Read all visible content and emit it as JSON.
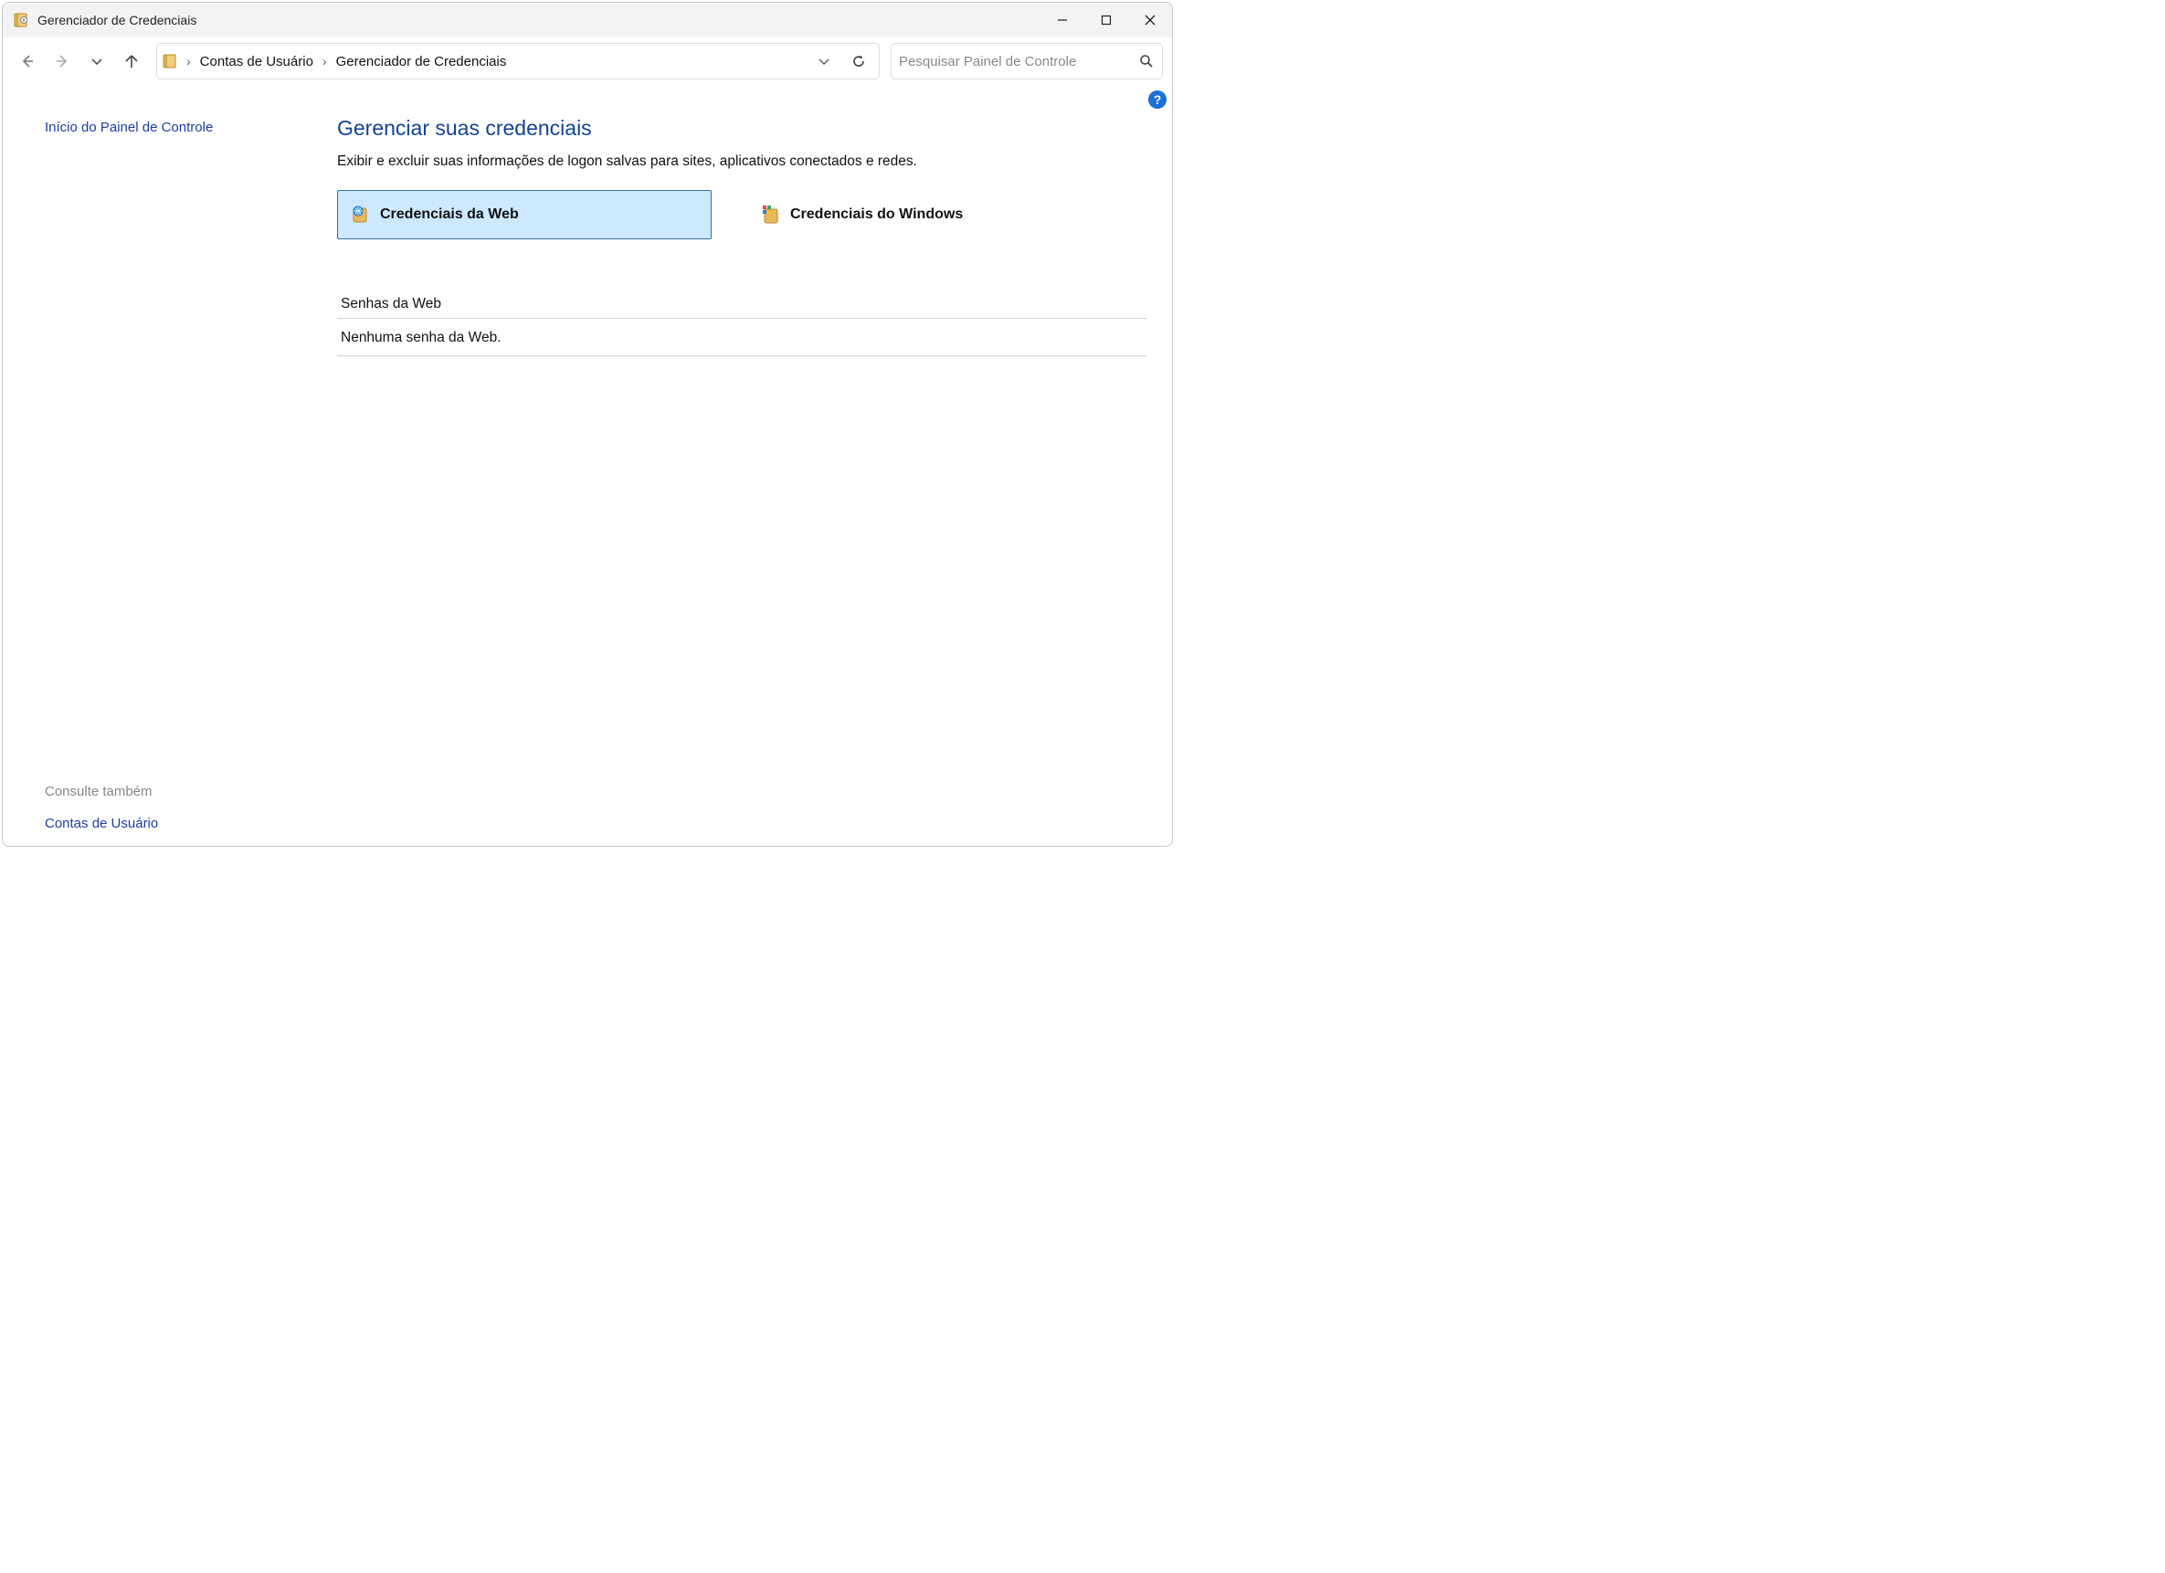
{
  "window": {
    "title": "Gerenciador de Credenciais"
  },
  "breadcrumb": {
    "items": [
      "Contas de Usuário",
      "Gerenciador de Credenciais"
    ]
  },
  "search": {
    "placeholder": "Pesquisar Painel de Controle"
  },
  "sidebar": {
    "home_link": "Início do Painel de Controle",
    "see_also_label": "Consulte também",
    "see_also_link": "Contas de Usuário"
  },
  "main": {
    "heading": "Gerenciar suas credenciais",
    "description": "Exibir e excluir suas informações de logon salvas para sites, aplicativos conectados e redes.",
    "tabs": [
      {
        "label": "Credenciais da Web",
        "active": true
      },
      {
        "label": "Credenciais do Windows",
        "active": false
      }
    ],
    "section_title": "Senhas da Web",
    "section_empty": "Nenhuma senha da Web."
  }
}
